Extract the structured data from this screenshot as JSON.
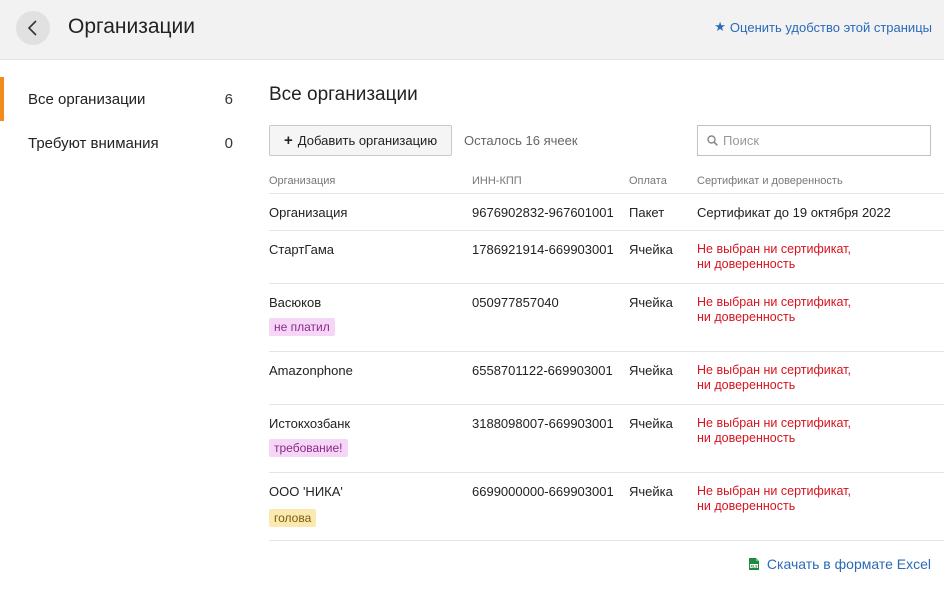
{
  "header": {
    "title": "Организации",
    "rate_link": "Оценить удобство этой страницы"
  },
  "sidebar": {
    "items": [
      {
        "label": "Все организации",
        "count": "6",
        "active": true
      },
      {
        "label": "Требуют внимания",
        "count": "0",
        "active": false
      }
    ]
  },
  "main": {
    "title": "Все организации",
    "add_button": "Добавить организацию",
    "remaining": "Осталось 16 ячеек",
    "search_placeholder": "Поиск",
    "columns": [
      "Организация",
      "ИНН-КПП",
      "Оплата",
      "Сертификат и доверенность"
    ],
    "rows": [
      {
        "name": "Организация",
        "inn": "9676902832-967601001",
        "payment": "Пакет",
        "cert_line1": "Сертификат до 19 октября 2022",
        "cert_line2": "",
        "cert_error": false,
        "badge": ""
      },
      {
        "name": "СтартГама",
        "inn": "1786921914-669903001",
        "payment": "Ячейка",
        "cert_line1": "Не выбран ни сертификат,",
        "cert_line2": "ни доверенность",
        "cert_error": true,
        "badge": ""
      },
      {
        "name": "Васюков",
        "inn": "050977857040",
        "payment": "Ячейка",
        "cert_line1": "Не выбран ни сертификат,",
        "cert_line2": "ни доверенность",
        "cert_error": true,
        "badge": "не платил"
      },
      {
        "name": "Amazonphone",
        "inn": "6558701122-669903001",
        "payment": "Ячейка",
        "cert_line1": "Не выбран ни сертификат,",
        "cert_line2": "ни доверенность",
        "cert_error": true,
        "badge": ""
      },
      {
        "name": "Истокхозбанк",
        "inn": "3188098007-669903001",
        "payment": "Ячейка",
        "cert_line1": "Не выбран ни сертификат,",
        "cert_line2": "ни доверенность",
        "cert_error": true,
        "badge": "требование!"
      },
      {
        "name": "ООО 'НИКА'",
        "inn": "6699000000-669903001",
        "payment": "Ячейка",
        "cert_line1": "Не выбран ни сертификат,",
        "cert_line2": "ни доверенность",
        "cert_error": true,
        "badge": "голова"
      }
    ],
    "excel_link": "Скачать в формате Excel"
  },
  "colors": {
    "accent_orange": "#f28a1e",
    "link_blue": "#2a6ab8",
    "error_red": "#d6141f",
    "badge_pink": "#f6d6f6",
    "badge_yellow": "#fbeab0",
    "excel_green": "#1f8a3d"
  },
  "icons": {
    "back": "chevron-left-icon",
    "star": "star-icon",
    "plus": "plus-icon",
    "search": "search-icon",
    "excel": "excel-file-icon"
  }
}
